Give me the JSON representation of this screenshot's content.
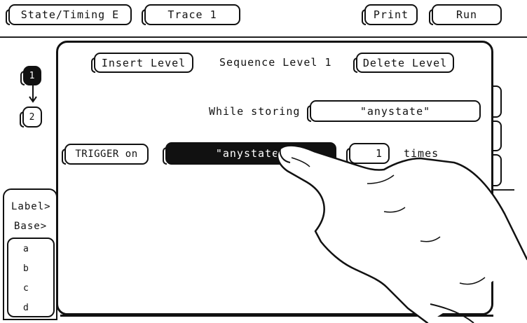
{
  "topbar": {
    "mode_label": "State/Timing E",
    "trace_label": "Trace 1",
    "print_label": "Print",
    "run_label": "Run"
  },
  "panel": {
    "insert_label": "Insert Level",
    "sequence_title": "Sequence Level 1",
    "delete_label": "Delete Level",
    "while_storing_label": "While storing",
    "while_storing_value": "\"anystate\"",
    "trigger_label": "TRIGGER on",
    "trigger_value": "\"anystate\"",
    "times_value": "1",
    "times_label": "times"
  },
  "levels": [
    {
      "label": "1",
      "selected": true
    },
    {
      "label": "2",
      "selected": false
    }
  ],
  "leftmenu": {
    "label_item": "Label>",
    "base_item": "Base>",
    "items": [
      "a",
      "b",
      "c",
      "d"
    ]
  }
}
